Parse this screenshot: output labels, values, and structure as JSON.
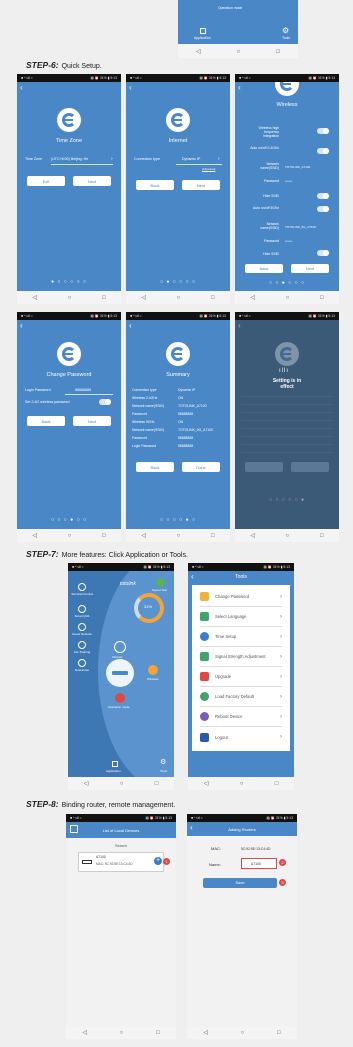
{
  "top_fragment": {
    "operation_mode": "Operation mode",
    "application": "Application",
    "tools": "Tools"
  },
  "steps": {
    "s6": {
      "label": "STEP-6:",
      "text": "Quick Setup."
    },
    "s7": {
      "label": "STEP-7:",
      "text": "More features: Click Application or Tools."
    },
    "s8": {
      "label": "STEP-8:",
      "text": "Binding router, remote management."
    }
  },
  "status": {
    "left": "■ ᴬ ull ≈",
    "right": "▩ ⏰ 31% ▮ 5:13"
  },
  "nav": {
    "back": "◁",
    "home": "○",
    "recent": "□"
  },
  "timezone": {
    "title": "Time Zone",
    "field_label": "Time Zone",
    "field_value": "(UTC+8:00) Beijing, He",
    "exit": "Exit",
    "next": "Next"
  },
  "internet": {
    "title": "Internet",
    "field_label": "Connection type",
    "field_value": "Dynamic IP",
    "advanced": "Advanced",
    "back": "Back",
    "next": "Next"
  },
  "wireless": {
    "title": "Wireless",
    "rows": [
      {
        "label": "Wireless high frequency integration",
        "value": ""
      },
      {
        "label": "Auto on/off 2.4GHz",
        "value": ""
      },
      {
        "label": "Network name(SSID)",
        "value": "TOTOLINK_A7100"
      },
      {
        "label": "Password",
        "value": "•••••••"
      },
      {
        "label": "Hide SSID",
        "value": ""
      },
      {
        "label": "Auto on/off 5GHz",
        "value": ""
      },
      {
        "label": "Network name(SSID)",
        "value": "TOTOLINK_5G_A7100"
      },
      {
        "label": "Password",
        "value": "•••••••"
      },
      {
        "label": "Hide SSID",
        "value": ""
      }
    ],
    "back": "Back",
    "next": "Next"
  },
  "changepw": {
    "title": "Change Password",
    "field_label": "Login Password",
    "field_value": "88888888",
    "same_label": "Set 2.4G wireless password",
    "back": "Back",
    "next": "Next"
  },
  "summary": {
    "title": "Summary",
    "rows": [
      {
        "label": "Connection type",
        "value": "Dynamic IP"
      },
      {
        "label": "Wireless 2.4GHz",
        "value": "ON"
      },
      {
        "label": "Network name(SSID)",
        "value": "TOTOLINK_A7100"
      },
      {
        "label": "Password",
        "value": "88888888"
      },
      {
        "label": "Wireless 5GHz",
        "value": "ON"
      },
      {
        "label": "Network name(SSID)",
        "value": "TOTOLINK_5G_A7100"
      },
      {
        "label": "Password",
        "value": "88888888"
      },
      {
        "label": "Login Password",
        "value": "88888888"
      }
    ],
    "back": "Back",
    "done": "Done"
  },
  "effect": {
    "line1": "Setting is in",
    "line2": "effect"
  },
  "main_app": {
    "brand": "totolink",
    "speed_test": "Speed Test",
    "percent": "31%",
    "side": [
      "Terminal Control",
      "Smart QoS",
      "Guest Network",
      "Life Training",
      "Guarantee"
    ],
    "internet": "Internet",
    "wireless": "Wireless",
    "operation_mode": "Operation mode",
    "application": "Application",
    "tools": "Tools"
  },
  "tools": {
    "title": "Tools",
    "items": [
      {
        "label": "Change Password",
        "color": "#f0b33a"
      },
      {
        "label": "Select Language",
        "color": "#3fa56a"
      },
      {
        "label": "Time Setup",
        "color": "#3a7bd5"
      },
      {
        "label": "Signal Strength Adjustment",
        "color": "#3fa56a"
      },
      {
        "label": "Upgrade",
        "color": "#e04848"
      },
      {
        "label": "Load Factory Default",
        "color": "#3fa56a"
      },
      {
        "label": "Reboot Device",
        "color": "#7a5bc2"
      },
      {
        "label": "Logout",
        "color": "#2a5aa8"
      }
    ]
  },
  "local_devices": {
    "title": "List of Local Devices",
    "search": "Search",
    "device_name": "A7100",
    "device_mac": "MAC: 5C:92:5E:13:C4:4D",
    "badge": "1"
  },
  "binding": {
    "title": "Adding Routers",
    "mac_label": "MAC:",
    "mac_value": "5C:92:5E:13:C4:4D",
    "name_label": "Name:",
    "name_value": "A7100",
    "save": "Save",
    "badge2": "2",
    "badge3": "3"
  }
}
